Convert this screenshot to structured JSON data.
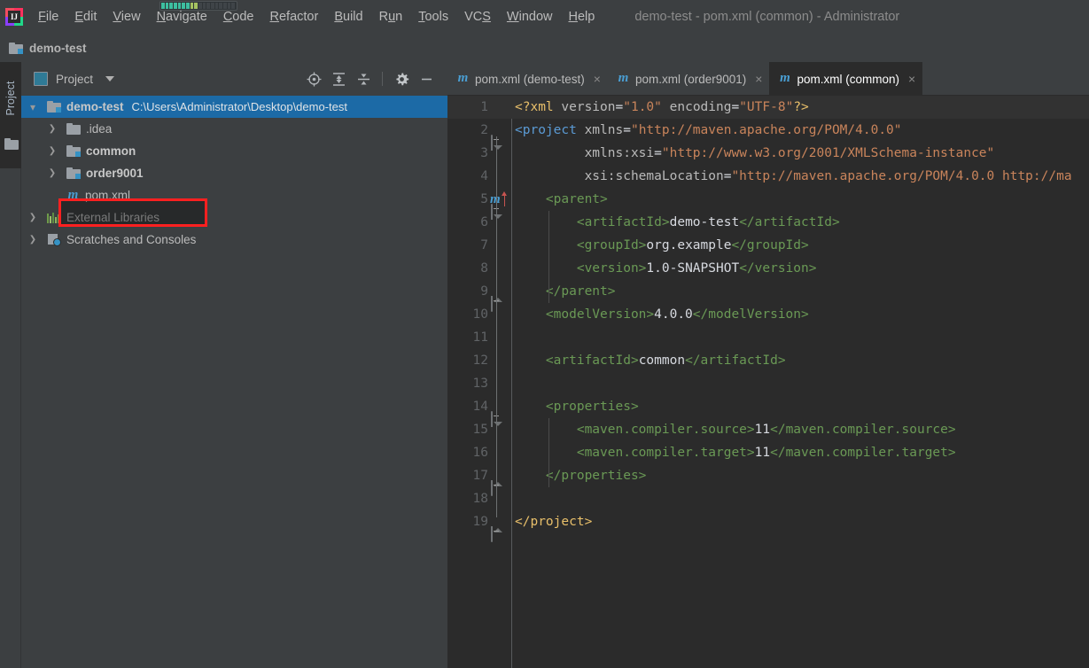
{
  "titlebar": {
    "logo_text": "IJ",
    "menus": [
      {
        "label": "File",
        "mnemonic": "F"
      },
      {
        "label": "Edit",
        "mnemonic": "E"
      },
      {
        "label": "View",
        "mnemonic": "V"
      },
      {
        "label": "Navigate",
        "mnemonic": "N"
      },
      {
        "label": "Code",
        "mnemonic": "C"
      },
      {
        "label": "Refactor",
        "mnemonic": "R"
      },
      {
        "label": "Build",
        "mnemonic": "B"
      },
      {
        "label": "Run",
        "mnemonic": "u"
      },
      {
        "label": "Tools",
        "mnemonic": "T"
      },
      {
        "label": "VCS",
        "mnemonic": "S"
      },
      {
        "label": "Window",
        "mnemonic": "W"
      },
      {
        "label": "Help",
        "mnemonic": "H"
      }
    ],
    "window_title": "demo-test - pom.xml (common) - Administrator",
    "progress_filled": 9,
    "progress_total": 18
  },
  "breadcrumb": {
    "project_name": "demo-test"
  },
  "tool_strip": {
    "vertical_tab": "Project"
  },
  "project_toolbar": {
    "view_label": "Project",
    "icons": [
      {
        "name": "locate-icon",
        "glyph": "target"
      },
      {
        "name": "expand-all-icon",
        "glyph": "expand"
      },
      {
        "name": "collapse-all-icon",
        "glyph": "collapse"
      },
      {
        "name": "settings-gear-icon",
        "glyph": "gear"
      },
      {
        "name": "hide-panel-icon",
        "glyph": "minus"
      }
    ]
  },
  "tree": {
    "rows": [
      {
        "label": "demo-test",
        "path": "C:\\Users\\Administrator\\Desktop\\demo-test",
        "icon": "module-folder-icon",
        "indent": 0,
        "expanded": true,
        "bold": true,
        "selected": true
      },
      {
        "label": ".idea",
        "path": "",
        "icon": "folder-icon",
        "indent": 1,
        "expanded": false,
        "bold": false,
        "selected": false
      },
      {
        "label": "common",
        "path": "",
        "icon": "module-folder-icon",
        "indent": 1,
        "expanded": false,
        "bold": true,
        "selected": false
      },
      {
        "label": "order9001",
        "path": "",
        "icon": "module-folder-icon",
        "indent": 1,
        "expanded": false,
        "bold": true,
        "selected": false
      },
      {
        "label": "pom.xml",
        "path": "",
        "icon": "maven-file-icon",
        "indent": 1,
        "expanded": null,
        "bold": false,
        "selected": false
      },
      {
        "label": "External Libraries",
        "path": "",
        "icon": "libraries-icon",
        "indent": 0,
        "expanded": false,
        "bold": false,
        "selected": false
      },
      {
        "label": "Scratches and Consoles",
        "path": "",
        "icon": "scratches-icon",
        "indent": 0,
        "expanded": false,
        "bold": false,
        "selected": false
      }
    ]
  },
  "annotation": {
    "highlight_color": "#ff2020",
    "target_row_label": "common"
  },
  "editor": {
    "tabs": [
      {
        "label": "pom.xml (demo-test)",
        "icon": "maven-file-icon",
        "active": false
      },
      {
        "label": "pom.xml (order9001)",
        "icon": "maven-file-icon",
        "active": false
      },
      {
        "label": "pom.xml (common)",
        "icon": "maven-file-icon",
        "active": true
      }
    ],
    "lines": [
      {
        "num": "1",
        "highlight": true,
        "fold": "",
        "maven_marker": false,
        "segments": [
          {
            "t": "<?xml ",
            "c": "tag"
          },
          {
            "t": "version",
            "c": "attr"
          },
          {
            "t": "=",
            "c": "white"
          },
          {
            "t": "\"1.0\"",
            "c": "str"
          },
          {
            "t": " ",
            "c": "txt"
          },
          {
            "t": "encoding",
            "c": "attr"
          },
          {
            "t": "=",
            "c": "white"
          },
          {
            "t": "\"UTF-8\"",
            "c": "str"
          },
          {
            "t": "?>",
            "c": "tag"
          }
        ]
      },
      {
        "num": "2",
        "highlight": false,
        "fold": "open",
        "maven_marker": false,
        "segments": [
          {
            "t": "<project ",
            "c": "tagb"
          },
          {
            "t": "xmlns",
            "c": "attr"
          },
          {
            "t": "=",
            "c": "white"
          },
          {
            "t": "\"http://maven.apache.org/POM/4.0.0\"",
            "c": "str"
          }
        ]
      },
      {
        "num": "3",
        "highlight": false,
        "fold": "",
        "maven_marker": false,
        "segments": [
          {
            "t": "         ",
            "c": "txt"
          },
          {
            "t": "xmlns:xsi",
            "c": "attr"
          },
          {
            "t": "=",
            "c": "white"
          },
          {
            "t": "\"http://www.w3.org/2001/XMLSchema-instance\"",
            "c": "str"
          }
        ]
      },
      {
        "num": "4",
        "highlight": false,
        "fold": "",
        "maven_marker": false,
        "segments": [
          {
            "t": "         ",
            "c": "txt"
          },
          {
            "t": "xsi:schemaLocation",
            "c": "attr"
          },
          {
            "t": "=",
            "c": "white"
          },
          {
            "t": "\"http://maven.apache.org/POM/4.0.0 http://ma",
            "c": "str"
          }
        ]
      },
      {
        "num": "5",
        "highlight": false,
        "fold": "open",
        "maven_marker": true,
        "segments": [
          {
            "t": "    ",
            "c": "txt"
          },
          {
            "t": "<parent>",
            "c": "tagg"
          }
        ]
      },
      {
        "num": "6",
        "highlight": false,
        "fold": "",
        "maven_marker": false,
        "segments": [
          {
            "t": "        ",
            "c": "txt"
          },
          {
            "t": "<artifactId>",
            "c": "tagg"
          },
          {
            "t": "demo-test",
            "c": "white"
          },
          {
            "t": "</artifactId>",
            "c": "tagg"
          }
        ]
      },
      {
        "num": "7",
        "highlight": false,
        "fold": "",
        "maven_marker": false,
        "segments": [
          {
            "t": "        ",
            "c": "txt"
          },
          {
            "t": "<groupId>",
            "c": "tagg"
          },
          {
            "t": "org.example",
            "c": "white"
          },
          {
            "t": "</groupId>",
            "c": "tagg"
          }
        ]
      },
      {
        "num": "8",
        "highlight": false,
        "fold": "",
        "maven_marker": false,
        "segments": [
          {
            "t": "        ",
            "c": "txt"
          },
          {
            "t": "<version>",
            "c": "tagg"
          },
          {
            "t": "1.0-SNAPSHOT",
            "c": "white"
          },
          {
            "t": "</version>",
            "c": "tagg"
          }
        ]
      },
      {
        "num": "9",
        "highlight": false,
        "fold": "close",
        "maven_marker": false,
        "segments": [
          {
            "t": "    ",
            "c": "txt"
          },
          {
            "t": "</parent>",
            "c": "tagg"
          }
        ]
      },
      {
        "num": "10",
        "highlight": false,
        "fold": "",
        "maven_marker": false,
        "segments": [
          {
            "t": "    ",
            "c": "txt"
          },
          {
            "t": "<modelVersion>",
            "c": "tagg"
          },
          {
            "t": "4.0.0",
            "c": "white"
          },
          {
            "t": "</modelVersion>",
            "c": "tagg"
          }
        ]
      },
      {
        "num": "11",
        "highlight": false,
        "fold": "",
        "maven_marker": false,
        "segments": []
      },
      {
        "num": "12",
        "highlight": false,
        "fold": "",
        "maven_marker": false,
        "segments": [
          {
            "t": "    ",
            "c": "txt"
          },
          {
            "t": "<artifactId>",
            "c": "tagg"
          },
          {
            "t": "common",
            "c": "white"
          },
          {
            "t": "</artifactId>",
            "c": "tagg"
          }
        ]
      },
      {
        "num": "13",
        "highlight": false,
        "fold": "",
        "maven_marker": false,
        "segments": []
      },
      {
        "num": "14",
        "highlight": false,
        "fold": "open",
        "maven_marker": false,
        "segments": [
          {
            "t": "    ",
            "c": "txt"
          },
          {
            "t": "<properties>",
            "c": "tagg"
          }
        ]
      },
      {
        "num": "15",
        "highlight": false,
        "fold": "",
        "maven_marker": false,
        "segments": [
          {
            "t": "        ",
            "c": "txt"
          },
          {
            "t": "<maven.compiler.source>",
            "c": "tagg"
          },
          {
            "t": "11",
            "c": "white"
          },
          {
            "t": "</maven.compiler.source>",
            "c": "tagg"
          }
        ]
      },
      {
        "num": "16",
        "highlight": false,
        "fold": "",
        "maven_marker": false,
        "segments": [
          {
            "t": "        ",
            "c": "txt"
          },
          {
            "t": "<maven.compiler.target>",
            "c": "tagg"
          },
          {
            "t": "11",
            "c": "white"
          },
          {
            "t": "</maven.compiler.target>",
            "c": "tagg"
          }
        ]
      },
      {
        "num": "17",
        "highlight": false,
        "fold": "close",
        "maven_marker": false,
        "segments": [
          {
            "t": "    ",
            "c": "txt"
          },
          {
            "t": "</properties>",
            "c": "tagg"
          }
        ]
      },
      {
        "num": "18",
        "highlight": false,
        "fold": "",
        "maven_marker": false,
        "segments": []
      },
      {
        "num": "19",
        "highlight": false,
        "fold": "close",
        "maven_marker": false,
        "segments": [
          {
            "t": "</project>",
            "c": "tag"
          }
        ]
      }
    ]
  },
  "colors": {
    "panel_bg": "#3c3f41",
    "editor_bg": "#2b2b2b",
    "selection_blue": "#1c6aa6",
    "accent_blue": "#3592c4",
    "text_primary": "#bbbbbb"
  }
}
